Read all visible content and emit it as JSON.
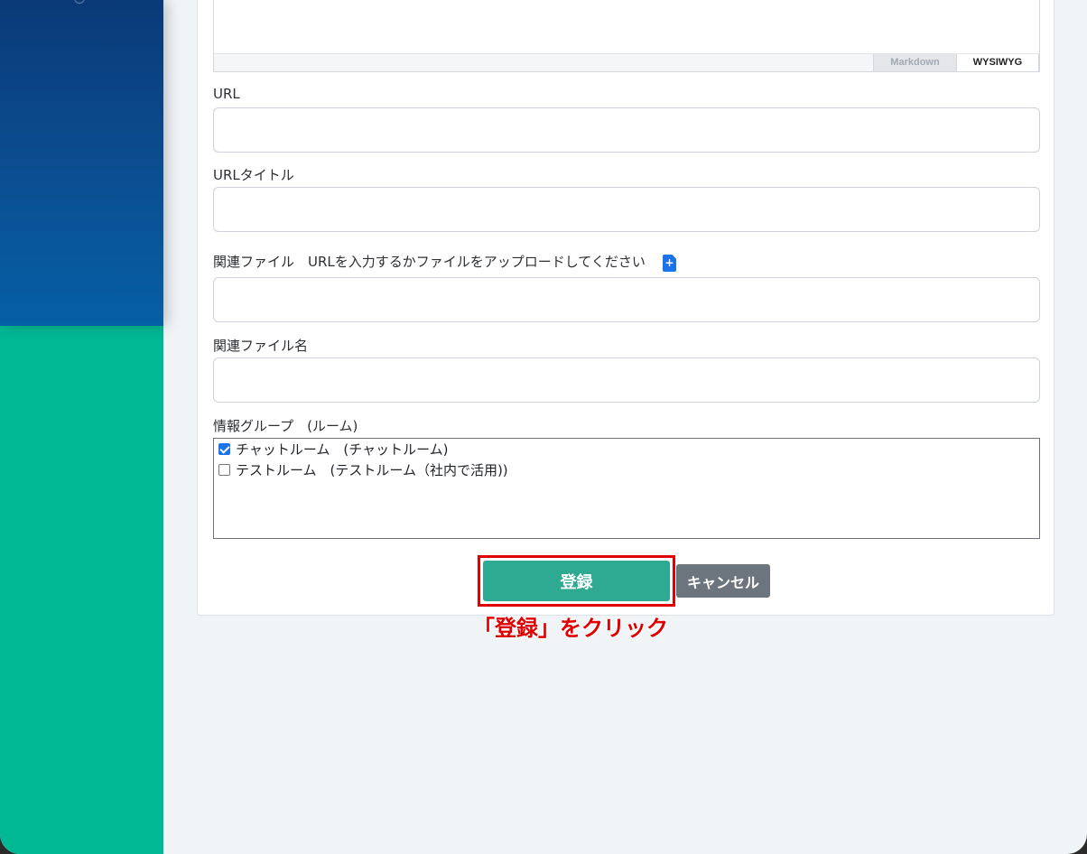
{
  "editor": {
    "mode_markdown": "Markdown",
    "mode_wysiwyg": "WYSIWYG"
  },
  "form": {
    "url_label": "URL",
    "url_value": "",
    "url_title_label": "URLタイトル",
    "url_title_value": "",
    "related_file_label": "関連ファイル　URLを入力するかファイルをアップロードしてください",
    "related_file_value": "",
    "related_file_name_label": "関連ファイル名",
    "related_file_name_value": "",
    "info_group_label": "情報グループ　(ルーム)",
    "groups": [
      {
        "label": "チャットルーム　(チャットルーム)",
        "checked": true
      },
      {
        "label": "テストルーム　(テストルーム（社内で活用))",
        "checked": false
      }
    ]
  },
  "actions": {
    "submit_label": "登録",
    "cancel_label": "キャンセル"
  },
  "annotation": {
    "text": "「登録」をクリック",
    "color": "#e00000"
  },
  "colors": {
    "sidebar_top": "#0b4f92",
    "sidebar_bottom": "#00b894",
    "submit": "#2eaa92",
    "cancel": "#6c757d",
    "checkbox_accent": "#1a73e8"
  },
  "icons": {
    "file_upload": "file-plus-icon"
  }
}
